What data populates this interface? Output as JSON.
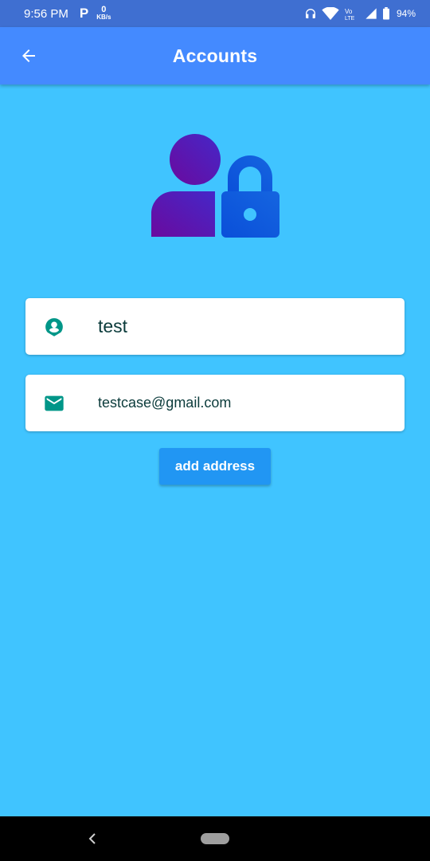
{
  "status_bar": {
    "time": "9:56 PM",
    "carrier_icon": "P",
    "net_speed_value": "0",
    "net_speed_unit": "KB/s",
    "battery": "94%",
    "icons": [
      "headset-icon",
      "wifi-icon",
      "volte-icon",
      "signal-icon",
      "battery-icon"
    ]
  },
  "app_bar": {
    "title": "Accounts",
    "back_icon": "arrow-left-icon"
  },
  "illustration": {
    "icon": "user-lock-icon",
    "colors": {
      "user": "#6a1b9a",
      "lock": "#1e56d6"
    }
  },
  "profile": {
    "name": "test",
    "name_icon": "account-circle-icon",
    "email": "testcase@gmail.com",
    "email_icon": "email-icon",
    "icon_color": "#009688"
  },
  "actions": {
    "add_address_label": "add address"
  },
  "nav_bar": {
    "back_icon": "nav-back-icon",
    "home_icon": "nav-home-pill"
  },
  "colors": {
    "background": "#40c4ff",
    "app_bar": "#448aff",
    "status_bar": "#3f6fd1",
    "button": "#2196f3"
  }
}
